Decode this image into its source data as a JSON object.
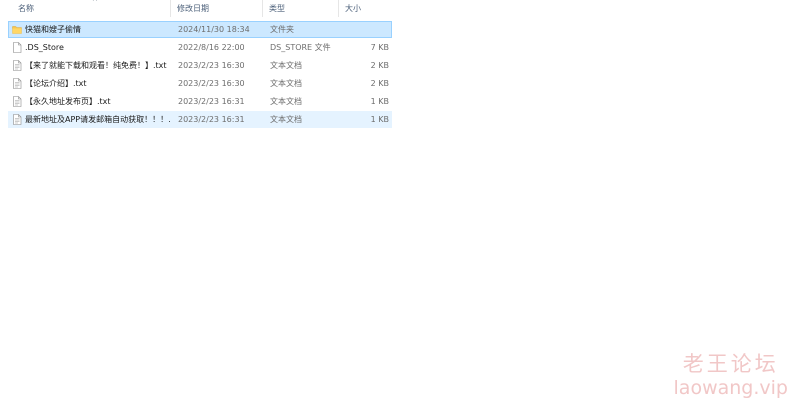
{
  "columns": {
    "name": "名称",
    "date": "修改日期",
    "type": "类型",
    "size": "大小"
  },
  "sort_indicator": "^",
  "files": [
    {
      "name": "快猫和嫂子偷情",
      "date": "2024/11/30 18:34",
      "type": "文件夹",
      "size": "",
      "icon": "folder-icon",
      "state": "selected"
    },
    {
      "name": ".DS_Store",
      "date": "2022/8/16 22:00",
      "type": "DS_STORE 文件",
      "size": "7 KB",
      "icon": "blank-file-icon",
      "state": ""
    },
    {
      "name": "【来了就能下载和观看！纯免费！】.txt",
      "date": "2023/2/23 16:30",
      "type": "文本文档",
      "size": "2 KB",
      "icon": "text-file-icon",
      "state": ""
    },
    {
      "name": "【论坛介绍】.txt",
      "date": "2023/2/23 16:30",
      "type": "文本文档",
      "size": "2 KB",
      "icon": "text-file-icon",
      "state": ""
    },
    {
      "name": "【永久地址发布页】.txt",
      "date": "2023/2/23 16:31",
      "type": "文本文档",
      "size": "1 KB",
      "icon": "text-file-icon",
      "state": ""
    },
    {
      "name": "最新地址及APP请发邮箱自动获取！！！...",
      "date": "2023/2/23 16:31",
      "type": "文本文档",
      "size": "1 KB",
      "icon": "text-file-icon",
      "state": "hover"
    }
  ],
  "watermark": {
    "title": "老王论坛",
    "url": "laowang.vip"
  },
  "colors": {
    "selected_bg": "#cce8ff",
    "selected_border": "#99d1ff",
    "hover_bg": "#e5f3ff",
    "folder": "#f8c64e",
    "watermark": "#f1c7c7"
  }
}
